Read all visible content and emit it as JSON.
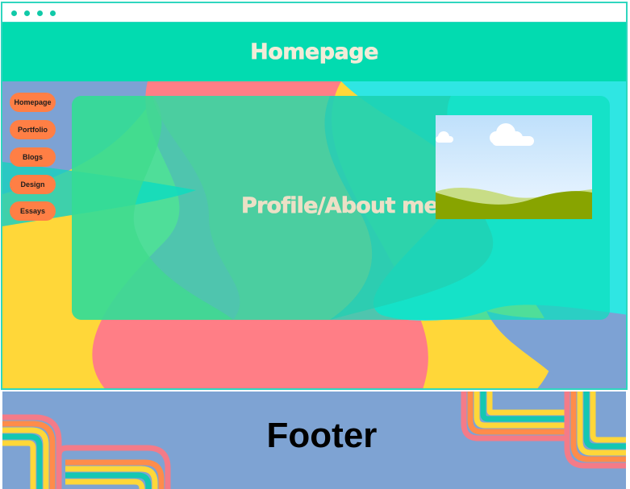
{
  "header": {
    "title": "Homepage"
  },
  "sidebar": {
    "items": [
      {
        "label": "Homepage"
      },
      {
        "label": "Portfolio"
      },
      {
        "label": "Blogs"
      },
      {
        "label": "Design"
      },
      {
        "label": "Essays"
      }
    ]
  },
  "main": {
    "card_title": "Profile/About me"
  },
  "footer": {
    "title": "Footer"
  },
  "icons": {
    "window_dots": "window-dot-icon",
    "image": "image-placeholder-icon"
  },
  "colors": {
    "header_bg": "#02dbb0",
    "nav_button": "#ff7f45",
    "card_bg": "#0be0be",
    "frame_border": "#2fd6bf",
    "page_bg": "#7da2d4"
  }
}
